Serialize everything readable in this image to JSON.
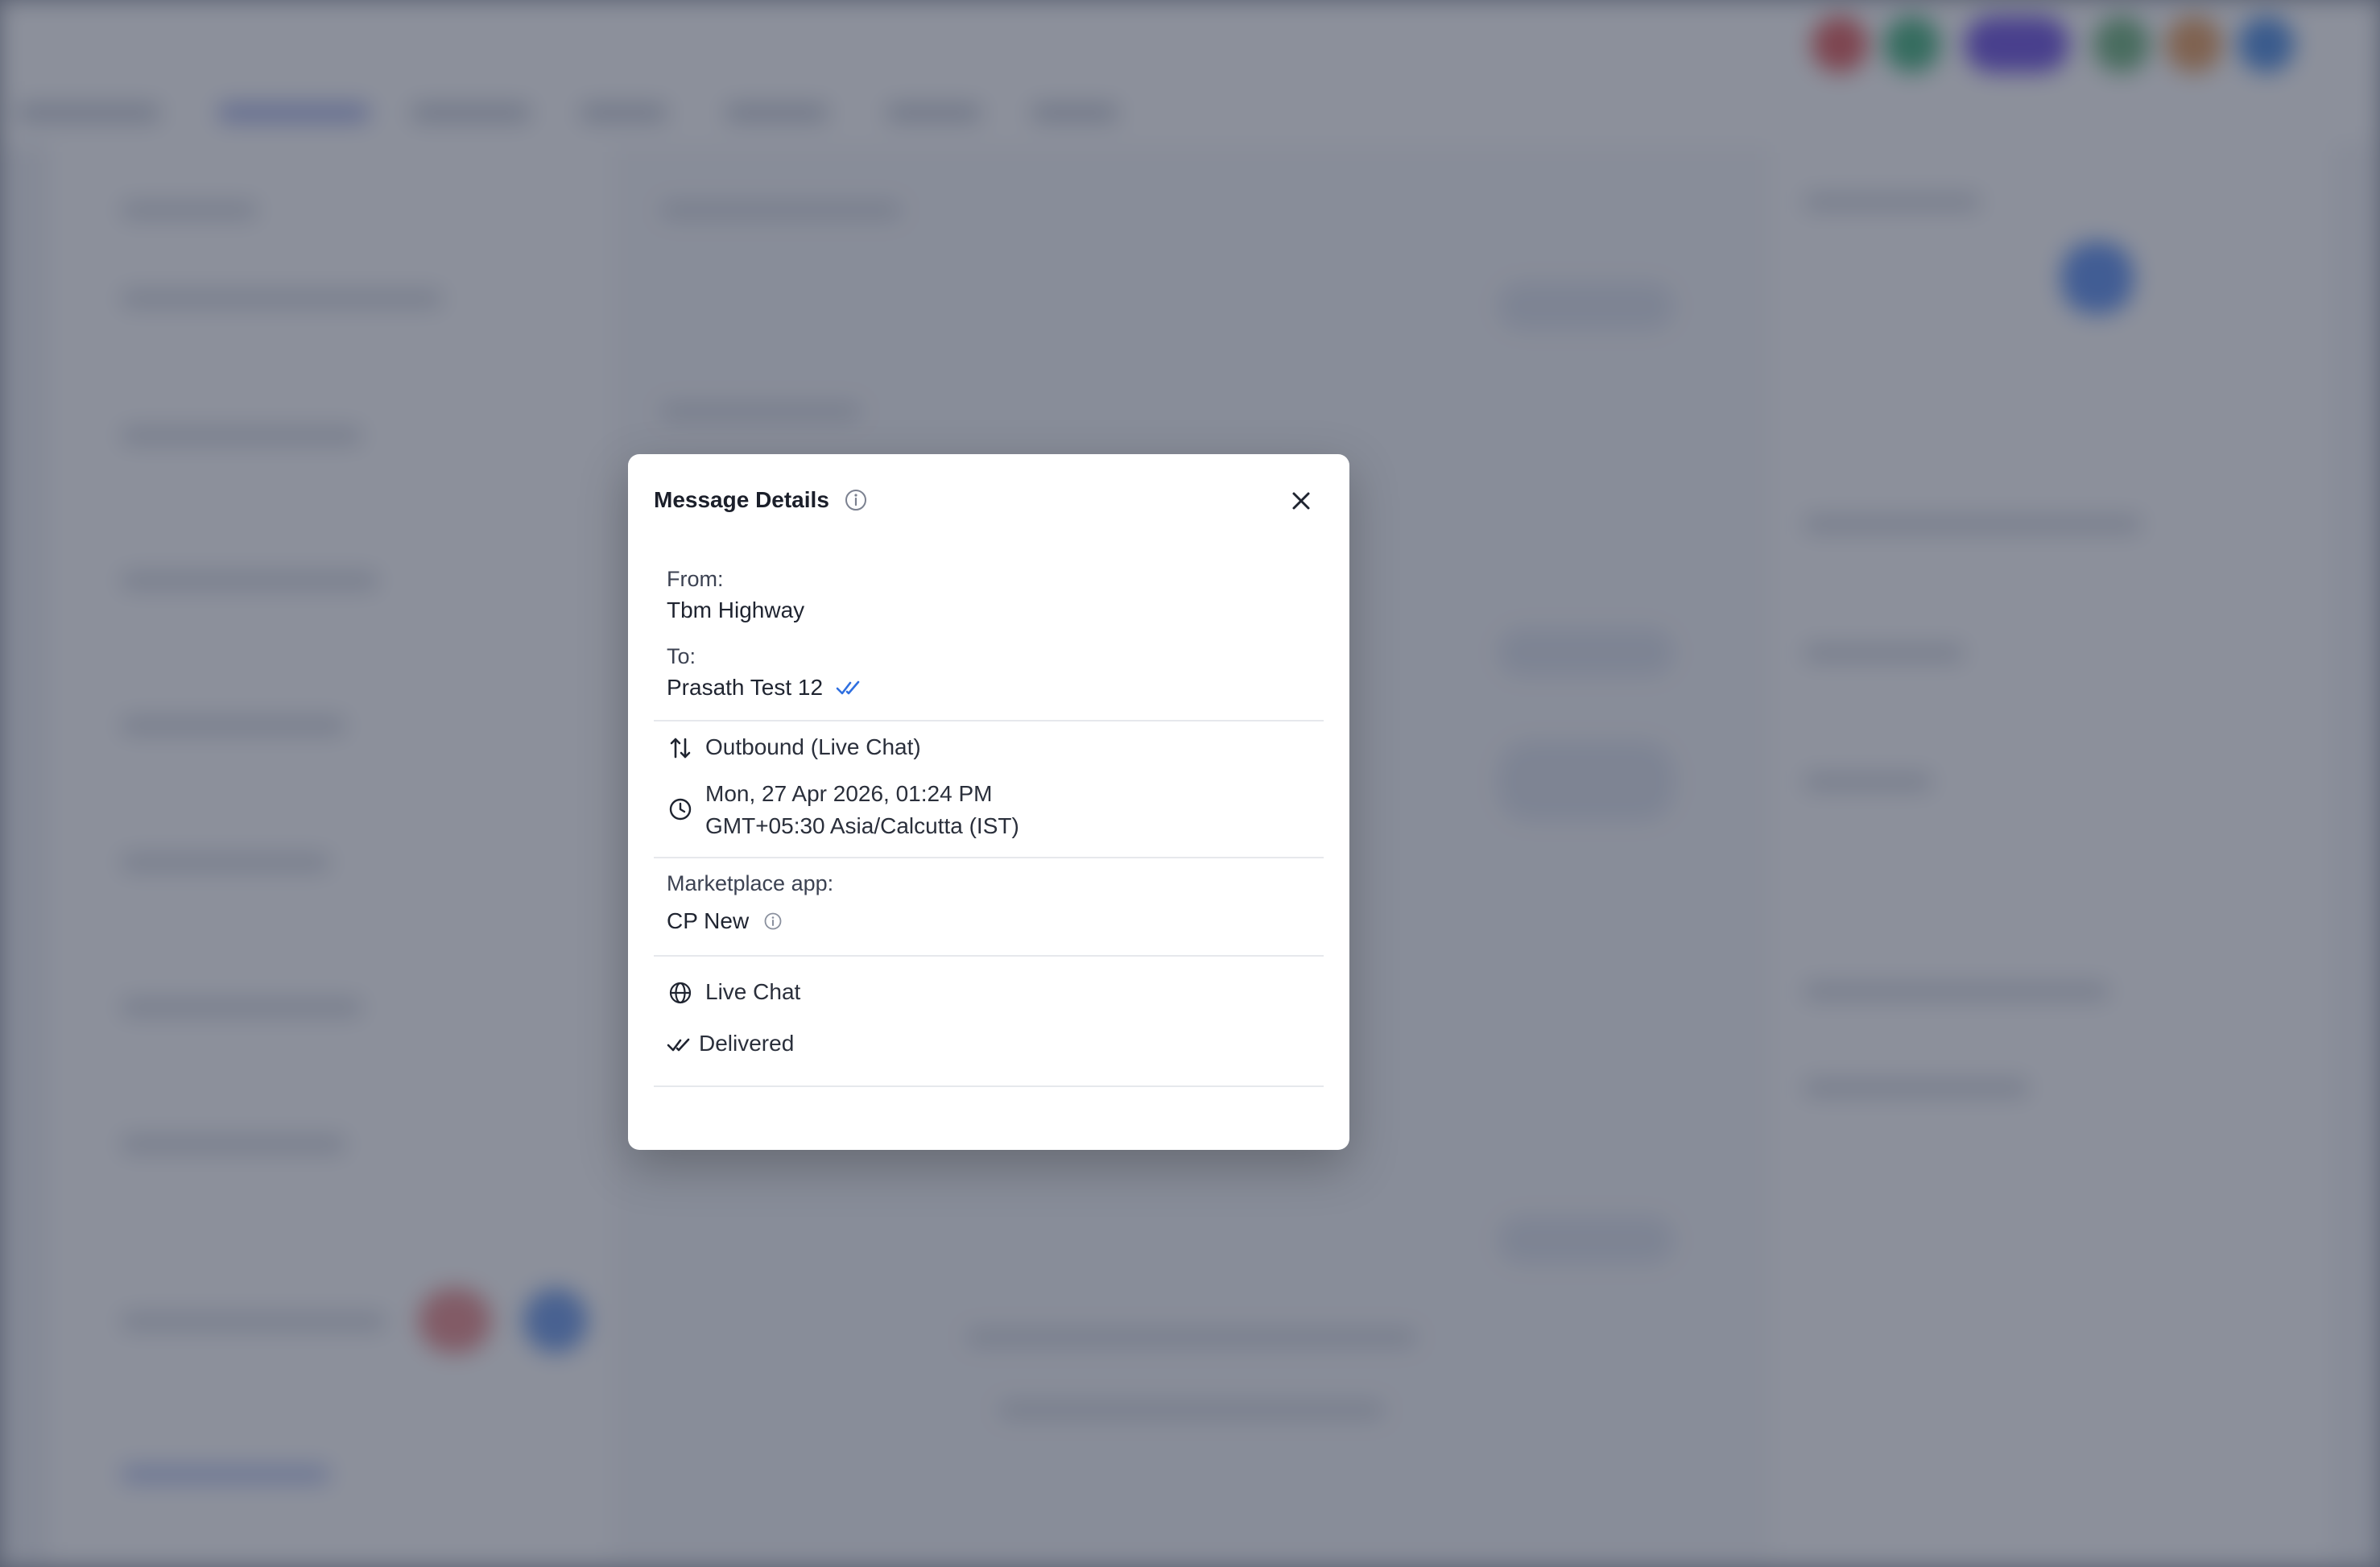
{
  "modal": {
    "title": "Message Details",
    "from": {
      "label": "From:",
      "value": "Tbm Highway"
    },
    "to": {
      "label": "To:",
      "value": "Prasath Test 12"
    },
    "direction": "Outbound (Live Chat)",
    "timestamp": {
      "date": "Mon, 27 Apr 2026, 01:24 PM",
      "timezone": "GMT+05:30 Asia/Calcutta (IST)"
    },
    "marketplace": {
      "label": "Marketplace app:",
      "value": "CP New"
    },
    "channel": "Live Chat",
    "status": "Delivered"
  },
  "icons": {
    "title_info": "info-icon",
    "close": "close-icon",
    "read_receipt": "double-check-icon",
    "direction": "swap-vertical-icon",
    "time": "clock-icon",
    "marketplace_info": "info-icon",
    "channel": "globe-icon",
    "status": "double-check-icon"
  },
  "colors": {
    "accent": "#2f6fe0",
    "overlay": "#5a6070"
  }
}
